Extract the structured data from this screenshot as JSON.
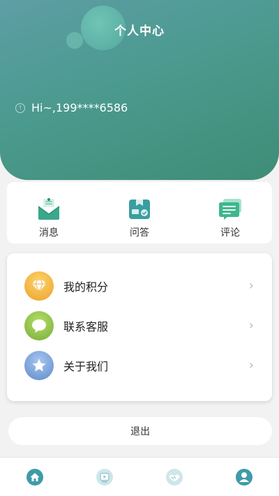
{
  "header": {
    "title": "个人中心",
    "greeting": "Hi~,199****6586"
  },
  "quick_actions": [
    {
      "label": "消息",
      "icon": "envelope-icon"
    },
    {
      "label": "问答",
      "icon": "qa-box-icon"
    },
    {
      "label": "评论",
      "icon": "comment-list-icon"
    }
  ],
  "menu": {
    "items": [
      {
        "label": "我的积分",
        "icon": "diamond-icon",
        "color": "#f0b13a"
      },
      {
        "label": "联系客服",
        "icon": "chat-bubble-icon",
        "color": "#8cc04a"
      },
      {
        "label": "关于我们",
        "icon": "star-icon",
        "color": "#6e9ad6"
      }
    ]
  },
  "logout_label": "退出",
  "tabs": [
    {
      "name": "home",
      "icon": "home-icon"
    },
    {
      "name": "video",
      "icon": "video-icon"
    },
    {
      "name": "handshake",
      "icon": "handshake-icon"
    },
    {
      "name": "profile",
      "icon": "profile-icon"
    }
  ],
  "colors": {
    "header_start": "#5e9ea5",
    "header_end": "#3e8d76",
    "accent": "#3aa88a"
  }
}
